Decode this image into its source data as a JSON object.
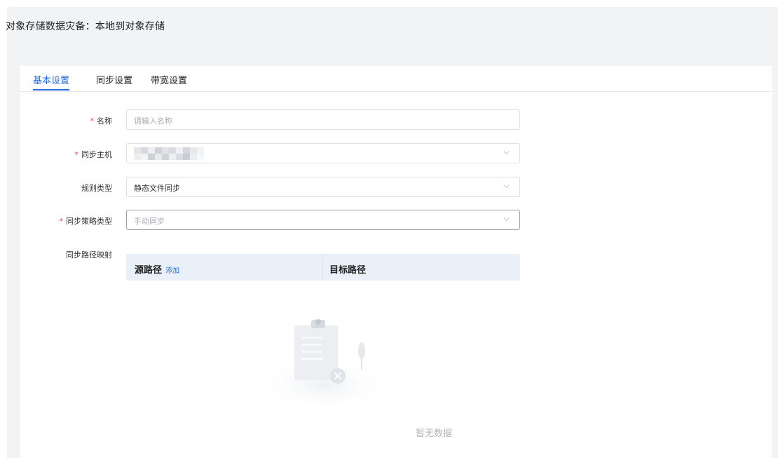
{
  "page": {
    "title": "对象存储数据灾备：本地到对象存储"
  },
  "tabs": [
    {
      "label": "基本设置",
      "active": true
    },
    {
      "label": "同步设置",
      "active": false
    },
    {
      "label": "带宽设置",
      "active": false
    }
  ],
  "form": {
    "name": {
      "label": "名称",
      "required": true,
      "placeholder": "请输入名称",
      "value": ""
    },
    "host": {
      "label": "同步主机",
      "required": true,
      "value_redacted": true
    },
    "rule_type": {
      "label": "规则类型",
      "required": false,
      "value": "静态文件同步"
    },
    "strategy_type": {
      "label": "同步策略类型",
      "required": true,
      "value": "手动同步"
    },
    "path_mapping": {
      "label": "同步路径映射",
      "columns": {
        "source": "源路径",
        "add": "添加",
        "target": "目标路径"
      },
      "empty_text": "暂无数据"
    },
    "required_mark": "*"
  },
  "colors": {
    "accent": "#2b6bdc",
    "required": "#e5484d",
    "page_bg": "#f2f3f5",
    "table_head_bg": "#eaf0f8"
  }
}
